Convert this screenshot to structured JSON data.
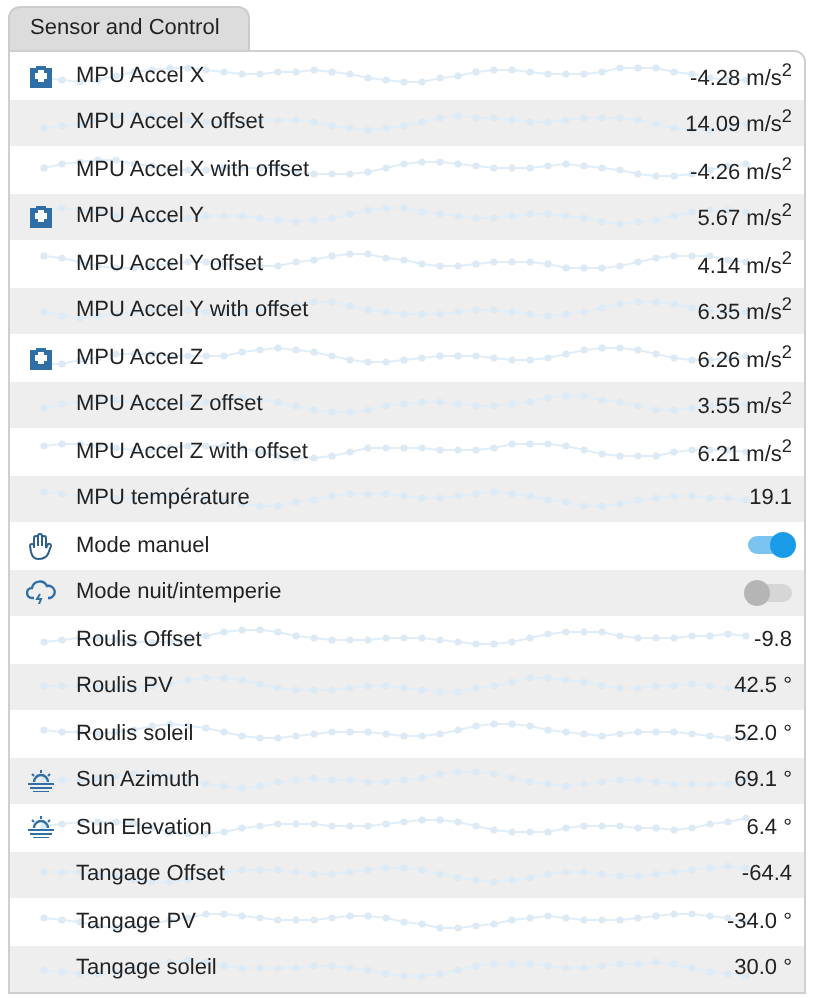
{
  "tab": {
    "label": "Sensor and Control",
    "selected": true
  },
  "rows": [
    {
      "kind": "accel",
      "label": "MPU Accel X",
      "value": "-4.28 m/s$^{2}$"
    },
    {
      "kind": "reading",
      "label": "MPU Accel X offset",
      "value": "14.09 m/s$^{2}$"
    },
    {
      "kind": "reading",
      "label": "MPU Accel X with offset",
      "value": "-4.26 m/s$^{2}$"
    },
    {
      "kind": "accel",
      "label": "MPU Accel Y",
      "value": "5.67 m/s$^{2}$"
    },
    {
      "kind": "reading",
      "label": "MPU Accel Y offset",
      "value": "4.14 m/s$^{2}$"
    },
    {
      "kind": "reading",
      "label": "MPU Accel Y with offset",
      "value": "6.35 m/s$^{2}$"
    },
    {
      "kind": "accel",
      "label": "MPU Accel Z",
      "value": "6.26 m/s$^{2}$"
    },
    {
      "kind": "reading",
      "label": "MPU Accel Z offset",
      "value": "3.55 m/s$^{2}$"
    },
    {
      "kind": "reading",
      "label": "MPU Accel Z with offset",
      "value": "6.21 m/s$^{2}$"
    },
    {
      "kind": "reading",
      "label": "MPU température",
      "value": "19.1"
    },
    {
      "kind": "manual",
      "label": "Mode manuel",
      "on": true
    },
    {
      "kind": "weather",
      "label": "Mode nuit/intemperie",
      "on": false
    },
    {
      "kind": "reading",
      "label": "Roulis Offset",
      "value": "-9.8"
    },
    {
      "kind": "reading",
      "label": "Roulis PV",
      "value": "42.5 °"
    },
    {
      "kind": "reading",
      "label": "Roulis soleil",
      "value": "52.0 °"
    },
    {
      "kind": "sun",
      "label": "Sun Azimuth",
      "value": "69.1 °"
    },
    {
      "kind": "sun",
      "label": "Sun Elevation",
      "value": "6.4 °"
    },
    {
      "kind": "reading",
      "label": "Tangage Offset",
      "value": "-64.4"
    },
    {
      "kind": "reading",
      "label": "Tangage PV",
      "value": "-34.0 °"
    },
    {
      "kind": "reading",
      "label": "Tangage soleil",
      "value": "30.0 °"
    }
  ]
}
